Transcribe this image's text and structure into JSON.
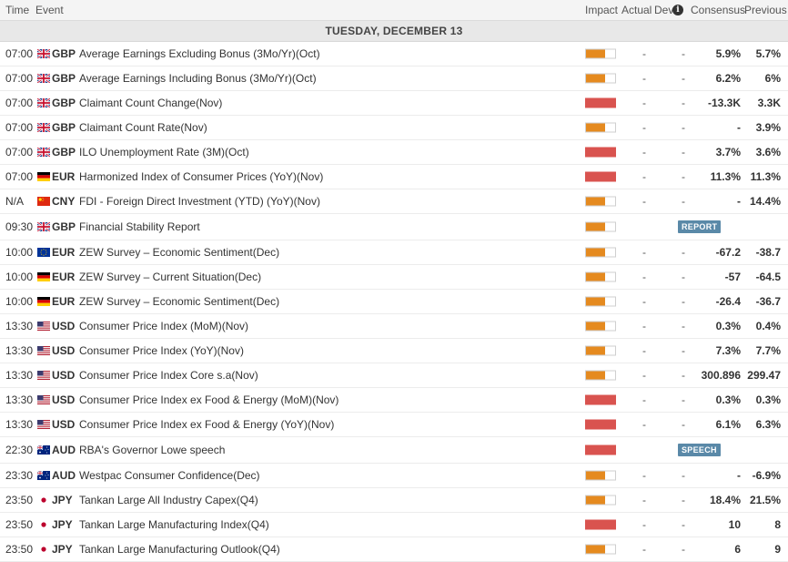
{
  "header": {
    "time": "Time",
    "event": "Event",
    "impact": "Impact",
    "actual": "Actual",
    "dev": "Dev",
    "consensus": "Consensus",
    "previous": "Previous"
  },
  "day_label": "TUESDAY, DECEMBER 13",
  "colors": {
    "medium": "#e58a1f",
    "high": "#d9534f",
    "badge": "#5a89a8"
  },
  "events": [
    {
      "time": "07:00",
      "flag": "gb",
      "currency": "GBP",
      "event": "Average Earnings Excluding Bonus (3Mo/Yr)(Oct)",
      "impact": "medium",
      "actual": "-",
      "dev": "-",
      "consensus": "5.9%",
      "previous": "5.7%"
    },
    {
      "time": "07:00",
      "flag": "gb",
      "currency": "GBP",
      "event": "Average Earnings Including Bonus (3Mo/Yr)(Oct)",
      "impact": "medium",
      "actual": "-",
      "dev": "-",
      "consensus": "6.2%",
      "previous": "6%"
    },
    {
      "time": "07:00",
      "flag": "gb",
      "currency": "GBP",
      "event": "Claimant Count Change(Nov)",
      "impact": "high",
      "actual": "-",
      "dev": "-",
      "consensus": "-13.3K",
      "previous": "3.3K"
    },
    {
      "time": "07:00",
      "flag": "gb",
      "currency": "GBP",
      "event": "Claimant Count Rate(Nov)",
      "impact": "medium",
      "actual": "-",
      "dev": "-",
      "consensus": "-",
      "previous": "3.9%"
    },
    {
      "time": "07:00",
      "flag": "gb",
      "currency": "GBP",
      "event": "ILO Unemployment Rate (3M)(Oct)",
      "impact": "high",
      "actual": "-",
      "dev": "-",
      "consensus": "3.7%",
      "previous": "3.6%"
    },
    {
      "time": "07:00",
      "flag": "de",
      "currency": "EUR",
      "event": "Harmonized Index of Consumer Prices (YoY)(Nov)",
      "impact": "high",
      "actual": "-",
      "dev": "-",
      "consensus": "11.3%",
      "previous": "11.3%"
    },
    {
      "time": "N/A",
      "flag": "cn",
      "currency": "CNY",
      "event": "FDI - Foreign Direct Investment (YTD) (YoY)(Nov)",
      "impact": "medium",
      "actual": "-",
      "dev": "-",
      "consensus": "-",
      "previous": "14.4%"
    },
    {
      "time": "09:30",
      "flag": "gb",
      "currency": "GBP",
      "event": "Financial Stability Report",
      "impact": "medium",
      "badge": "REPORT",
      "tall": true
    },
    {
      "time": "10:00",
      "flag": "eu",
      "currency": "EUR",
      "event": "ZEW Survey – Economic Sentiment(Dec)",
      "impact": "medium",
      "actual": "-",
      "dev": "-",
      "consensus": "-67.2",
      "previous": "-38.7"
    },
    {
      "time": "10:00",
      "flag": "de",
      "currency": "EUR",
      "event": "ZEW Survey – Current Situation(Dec)",
      "impact": "medium",
      "actual": "-",
      "dev": "-",
      "consensus": "-57",
      "previous": "-64.5"
    },
    {
      "time": "10:00",
      "flag": "de",
      "currency": "EUR",
      "event": "ZEW Survey – Economic Sentiment(Dec)",
      "impact": "medium",
      "actual": "-",
      "dev": "-",
      "consensus": "-26.4",
      "previous": "-36.7"
    },
    {
      "time": "13:30",
      "flag": "us",
      "currency": "USD",
      "event": "Consumer Price Index (MoM)(Nov)",
      "impact": "medium",
      "actual": "-",
      "dev": "-",
      "consensus": "0.3%",
      "previous": "0.4%"
    },
    {
      "time": "13:30",
      "flag": "us",
      "currency": "USD",
      "event": "Consumer Price Index (YoY)(Nov)",
      "impact": "medium",
      "actual": "-",
      "dev": "-",
      "consensus": "7.3%",
      "previous": "7.7%"
    },
    {
      "time": "13:30",
      "flag": "us",
      "currency": "USD",
      "event": "Consumer Price Index Core s.a(Nov)",
      "impact": "medium",
      "actual": "-",
      "dev": "-",
      "consensus": "300.896",
      "previous": "299.47"
    },
    {
      "time": "13:30",
      "flag": "us",
      "currency": "USD",
      "event": "Consumer Price Index ex Food & Energy (MoM)(Nov)",
      "impact": "high",
      "actual": "-",
      "dev": "-",
      "consensus": "0.3%",
      "previous": "0.3%"
    },
    {
      "time": "13:30",
      "flag": "us",
      "currency": "USD",
      "event": "Consumer Price Index ex Food & Energy (YoY)(Nov)",
      "impact": "high",
      "actual": "-",
      "dev": "-",
      "consensus": "6.1%",
      "previous": "6.3%"
    },
    {
      "time": "22:30",
      "flag": "au",
      "currency": "AUD",
      "event": "RBA's Governor Lowe speech",
      "impact": "high",
      "badge": "SPEECH",
      "tall": true
    },
    {
      "time": "23:30",
      "flag": "au",
      "currency": "AUD",
      "event": "Westpac Consumer Confidence(Dec)",
      "impact": "medium",
      "actual": "-",
      "dev": "-",
      "consensus": "-",
      "previous": "-6.9%"
    },
    {
      "time": "23:50",
      "flag": "jp",
      "currency": "JPY",
      "event": "Tankan Large All Industry Capex(Q4)",
      "impact": "medium",
      "actual": "-",
      "dev": "-",
      "consensus": "18.4%",
      "previous": "21.5%"
    },
    {
      "time": "23:50",
      "flag": "jp",
      "currency": "JPY",
      "event": "Tankan Large Manufacturing Index(Q4)",
      "impact": "high",
      "actual": "-",
      "dev": "-",
      "consensus": "10",
      "previous": "8"
    },
    {
      "time": "23:50",
      "flag": "jp",
      "currency": "JPY",
      "event": "Tankan Large Manufacturing Outlook(Q4)",
      "impact": "medium",
      "actual": "-",
      "dev": "-",
      "consensus": "6",
      "previous": "9"
    }
  ]
}
